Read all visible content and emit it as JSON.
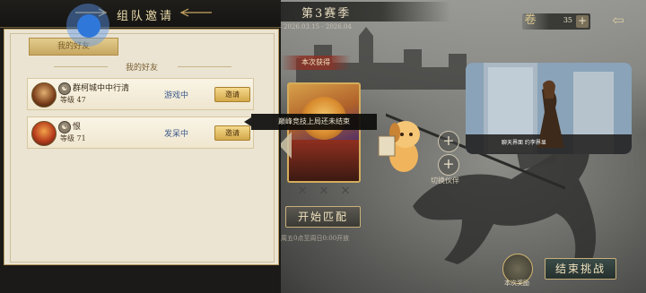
{
  "panel": {
    "title": "组队邀请",
    "tab_label": "我的好友",
    "section_title": "我的好友",
    "friends": [
      {
        "name": "群柯城中中行清",
        "badge": "☯",
        "level_label": "等级 47",
        "status": "游戏中",
        "invite_label": "邀请"
      },
      {
        "name": "恨",
        "badge": "☯",
        "level_label": "等级 71",
        "status": "发呆中",
        "invite_label": "邀请"
      }
    ]
  },
  "tooltip": {
    "text": "巅峰竞技上局还未结束"
  },
  "season": {
    "title": "第3赛季",
    "date_range": "2026.03.15 - 2026.04",
    "rewards_label": "本次获得"
  },
  "currency": {
    "value": "35",
    "plus": "+"
  },
  "actions": {
    "switch_label": "切换伙伴",
    "start_match": "开始匹配",
    "start_sub": "周五0点至周日0:00开放",
    "battle_reward_label": "本次奖励",
    "end_challenge": "结束挑战"
  },
  "video": {
    "caption": "聊天界面 约李界显"
  },
  "icons": {
    "currency": "scroll-icon",
    "corner": "back-arrow-icon",
    "badge": "yin-yang-icon",
    "plus": "plus-icon",
    "chevron": "chevron-left-icon"
  },
  "colors": {
    "panel_title": "#e9d9a8",
    "status_blue": "#3d5a8a",
    "invite_gold": "#d3a84a",
    "touch_blue": "#2f77d8"
  }
}
